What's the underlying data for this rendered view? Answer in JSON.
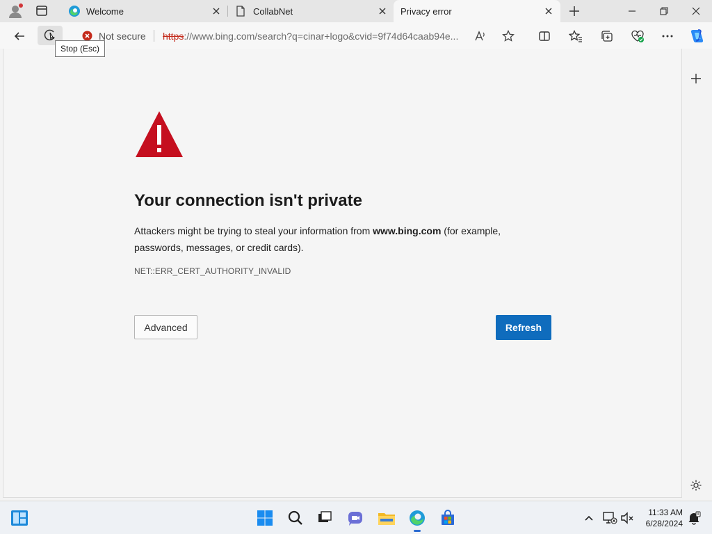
{
  "browser": {
    "tabs": [
      {
        "label": "Welcome",
        "icon": "edge-icon",
        "active": false
      },
      {
        "label": "CollabNet",
        "icon": "page-icon",
        "active": false
      },
      {
        "label": "Privacy error",
        "icon": "",
        "active": true
      }
    ],
    "address_bar": {
      "security_label": "Not secure",
      "url_scheme": "https",
      "url_rest": "://www.bing.com/search?q=cinar+logo&cvid=9f74d64caab94e..."
    },
    "tooltip": "Stop (Esc)"
  },
  "error_page": {
    "title": "Your connection isn't private",
    "description_before": "Attackers might be trying to steal your information from ",
    "description_host": "www.bing.com",
    "description_after": " (for example, passwords, messages, or credit cards).",
    "error_code": "NET::ERR_CERT_AUTHORITY_INVALID",
    "advanced_label": "Advanced",
    "refresh_label": "Refresh"
  },
  "taskbar": {
    "time": "11:33 AM",
    "date": "6/28/2024"
  },
  "colors": {
    "warning_red": "#c50f1f",
    "primary_button": "#0f6cbd",
    "not_secure_red": "#c42b1c"
  }
}
